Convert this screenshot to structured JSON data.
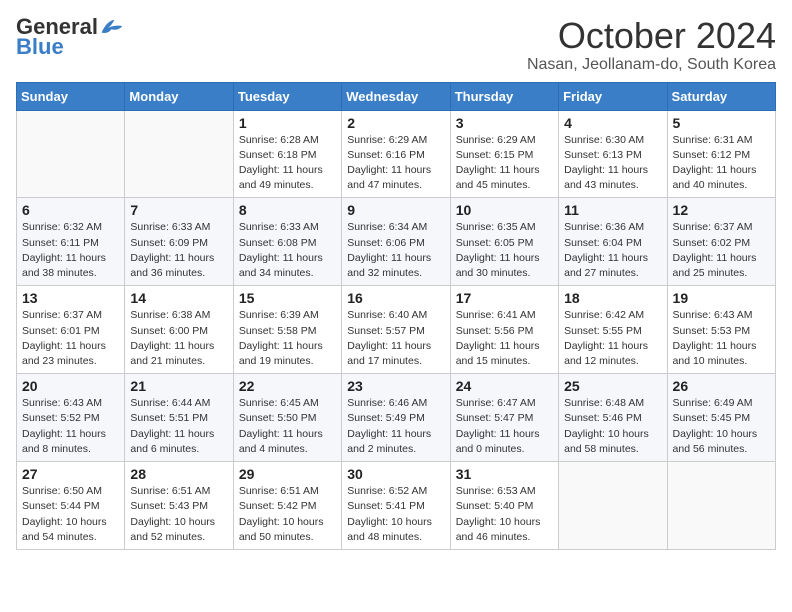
{
  "logo": {
    "general": "General",
    "blue": "Blue"
  },
  "title": "October 2024",
  "location": "Nasan, Jeollanam-do, South Korea",
  "days_of_week": [
    "Sunday",
    "Monday",
    "Tuesday",
    "Wednesday",
    "Thursday",
    "Friday",
    "Saturday"
  ],
  "weeks": [
    [
      {
        "day": "",
        "info": ""
      },
      {
        "day": "",
        "info": ""
      },
      {
        "day": "1",
        "info": "Sunrise: 6:28 AM\nSunset: 6:18 PM\nDaylight: 11 hours and 49 minutes."
      },
      {
        "day": "2",
        "info": "Sunrise: 6:29 AM\nSunset: 6:16 PM\nDaylight: 11 hours and 47 minutes."
      },
      {
        "day": "3",
        "info": "Sunrise: 6:29 AM\nSunset: 6:15 PM\nDaylight: 11 hours and 45 minutes."
      },
      {
        "day": "4",
        "info": "Sunrise: 6:30 AM\nSunset: 6:13 PM\nDaylight: 11 hours and 43 minutes."
      },
      {
        "day": "5",
        "info": "Sunrise: 6:31 AM\nSunset: 6:12 PM\nDaylight: 11 hours and 40 minutes."
      }
    ],
    [
      {
        "day": "6",
        "info": "Sunrise: 6:32 AM\nSunset: 6:11 PM\nDaylight: 11 hours and 38 minutes."
      },
      {
        "day": "7",
        "info": "Sunrise: 6:33 AM\nSunset: 6:09 PM\nDaylight: 11 hours and 36 minutes."
      },
      {
        "day": "8",
        "info": "Sunrise: 6:33 AM\nSunset: 6:08 PM\nDaylight: 11 hours and 34 minutes."
      },
      {
        "day": "9",
        "info": "Sunrise: 6:34 AM\nSunset: 6:06 PM\nDaylight: 11 hours and 32 minutes."
      },
      {
        "day": "10",
        "info": "Sunrise: 6:35 AM\nSunset: 6:05 PM\nDaylight: 11 hours and 30 minutes."
      },
      {
        "day": "11",
        "info": "Sunrise: 6:36 AM\nSunset: 6:04 PM\nDaylight: 11 hours and 27 minutes."
      },
      {
        "day": "12",
        "info": "Sunrise: 6:37 AM\nSunset: 6:02 PM\nDaylight: 11 hours and 25 minutes."
      }
    ],
    [
      {
        "day": "13",
        "info": "Sunrise: 6:37 AM\nSunset: 6:01 PM\nDaylight: 11 hours and 23 minutes."
      },
      {
        "day": "14",
        "info": "Sunrise: 6:38 AM\nSunset: 6:00 PM\nDaylight: 11 hours and 21 minutes."
      },
      {
        "day": "15",
        "info": "Sunrise: 6:39 AM\nSunset: 5:58 PM\nDaylight: 11 hours and 19 minutes."
      },
      {
        "day": "16",
        "info": "Sunrise: 6:40 AM\nSunset: 5:57 PM\nDaylight: 11 hours and 17 minutes."
      },
      {
        "day": "17",
        "info": "Sunrise: 6:41 AM\nSunset: 5:56 PM\nDaylight: 11 hours and 15 minutes."
      },
      {
        "day": "18",
        "info": "Sunrise: 6:42 AM\nSunset: 5:55 PM\nDaylight: 11 hours and 12 minutes."
      },
      {
        "day": "19",
        "info": "Sunrise: 6:43 AM\nSunset: 5:53 PM\nDaylight: 11 hours and 10 minutes."
      }
    ],
    [
      {
        "day": "20",
        "info": "Sunrise: 6:43 AM\nSunset: 5:52 PM\nDaylight: 11 hours and 8 minutes."
      },
      {
        "day": "21",
        "info": "Sunrise: 6:44 AM\nSunset: 5:51 PM\nDaylight: 11 hours and 6 minutes."
      },
      {
        "day": "22",
        "info": "Sunrise: 6:45 AM\nSunset: 5:50 PM\nDaylight: 11 hours and 4 minutes."
      },
      {
        "day": "23",
        "info": "Sunrise: 6:46 AM\nSunset: 5:49 PM\nDaylight: 11 hours and 2 minutes."
      },
      {
        "day": "24",
        "info": "Sunrise: 6:47 AM\nSunset: 5:47 PM\nDaylight: 11 hours and 0 minutes."
      },
      {
        "day": "25",
        "info": "Sunrise: 6:48 AM\nSunset: 5:46 PM\nDaylight: 10 hours and 58 minutes."
      },
      {
        "day": "26",
        "info": "Sunrise: 6:49 AM\nSunset: 5:45 PM\nDaylight: 10 hours and 56 minutes."
      }
    ],
    [
      {
        "day": "27",
        "info": "Sunrise: 6:50 AM\nSunset: 5:44 PM\nDaylight: 10 hours and 54 minutes."
      },
      {
        "day": "28",
        "info": "Sunrise: 6:51 AM\nSunset: 5:43 PM\nDaylight: 10 hours and 52 minutes."
      },
      {
        "day": "29",
        "info": "Sunrise: 6:51 AM\nSunset: 5:42 PM\nDaylight: 10 hours and 50 minutes."
      },
      {
        "day": "30",
        "info": "Sunrise: 6:52 AM\nSunset: 5:41 PM\nDaylight: 10 hours and 48 minutes."
      },
      {
        "day": "31",
        "info": "Sunrise: 6:53 AM\nSunset: 5:40 PM\nDaylight: 10 hours and 46 minutes."
      },
      {
        "day": "",
        "info": ""
      },
      {
        "day": "",
        "info": ""
      }
    ]
  ]
}
